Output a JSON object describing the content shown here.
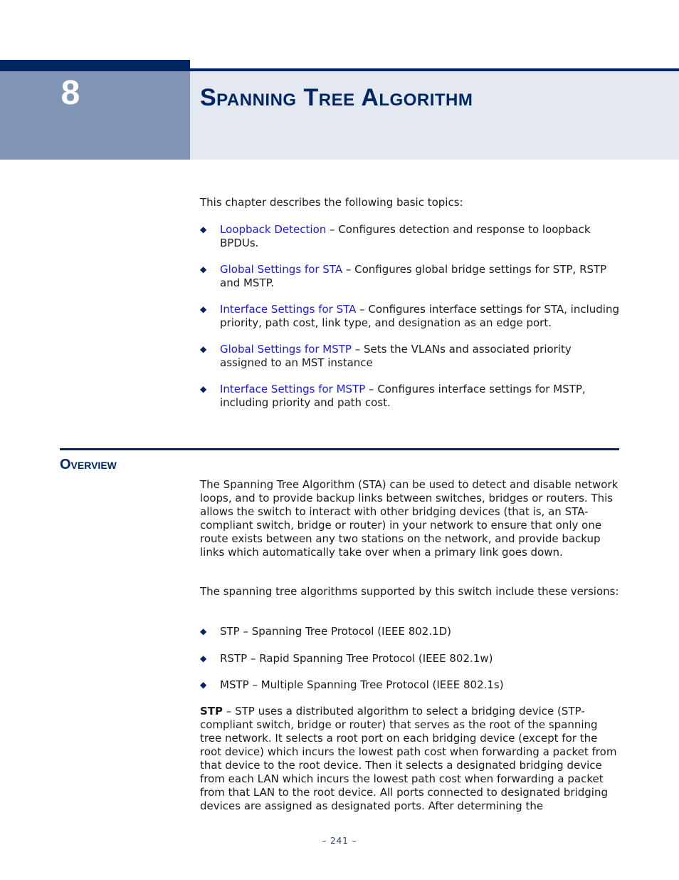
{
  "chapter": {
    "number": "8",
    "title": "Spanning Tree Algorithm"
  },
  "intro": {
    "text": "This chapter describes the following basic topics:",
    "topics": [
      {
        "link": "Loopback Detection",
        "desc": " – Configures detection and response to loopback BPDUs."
      },
      {
        "link": "Global Settings for STA",
        "desc": " – Configures global bridge settings for STP, RSTP and MSTP."
      },
      {
        "link": "Interface Settings for STA",
        "desc": " – Configures interface settings for STA, including priority, path cost, link type, and designation as an edge port."
      },
      {
        "link": "Global Settings for MSTP",
        "desc": " – Sets the VLANs and associated priority assigned to an MST instance"
      },
      {
        "link": "Interface Settings for MSTP",
        "desc": " – Configures interface settings for MSTP, including priority and path cost."
      }
    ]
  },
  "overview": {
    "heading": "Overview",
    "para1": "The Spanning Tree Algorithm (STA) can be used to detect and disable network loops, and to provide backup links between switches, bridges or routers. This allows the switch to interact with other bridging devices (that is, an STA-compliant switch, bridge or router) in your network to ensure that only one route exists between any two stations on the network, and provide backup links which automatically take over when a primary link goes down.",
    "para2": "The spanning tree algorithms supported by this switch include these versions:",
    "versions": [
      "STP – Spanning Tree Protocol (IEEE 802.1D)",
      "RSTP – Rapid Spanning Tree Protocol (IEEE 802.1w)",
      "MSTP – Multiple Spanning Tree Protocol (IEEE 802.1s)"
    ],
    "stp_label": "STP",
    "stp_text": " – STP uses a distributed algorithm to select a bridging device (STP-compliant switch, bridge or router) that serves as the root of the spanning tree network. It selects a root port on each bridging device (except for the root device) which incurs the lowest path cost when forwarding a packet from that device to the root device. Then it selects a designated bridging device from each LAN which incurs the lowest path cost when forwarding a packet from that LAN to the root device. All ports connected to designated bridging devices are assigned as designated ports. After determining the"
  },
  "footer": {
    "page_number": "–  241  –"
  },
  "icons": {
    "bullet": "◆"
  }
}
